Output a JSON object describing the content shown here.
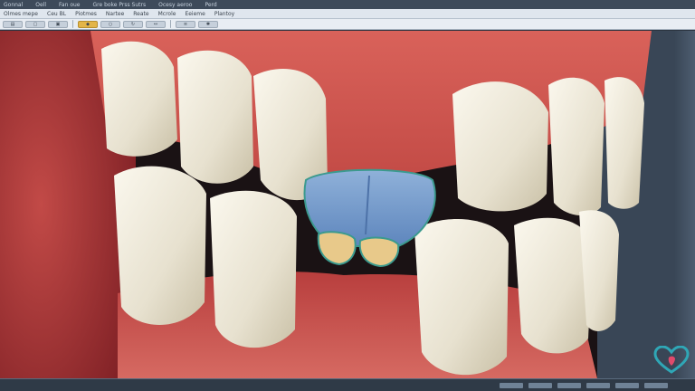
{
  "window": {
    "title_segments": [
      "Gonnal",
      "Oell",
      "Fan oue",
      "Gre boke Prss Sutrs",
      "Ocesy aeroo",
      "Perd"
    ]
  },
  "menubar": {
    "items": [
      "Olmes mepe",
      "Ceu BL",
      "Piotmes",
      "Nartee",
      "Reate",
      "Mcrole",
      "Eeieme",
      "Plantoy"
    ]
  },
  "toolbar": {
    "accent_color": "#e3b548",
    "tools": [
      "file-icon",
      "open-icon",
      "save-icon",
      "tooth-icon",
      "zoom-icon",
      "rotate-icon",
      "measure-icon",
      "layers-icon",
      "settings-icon"
    ]
  },
  "viewport": {
    "subject": "3D dental model — upper and lower teeth with highlighted blue gum/tooth region",
    "highlight_color": "#6f95c6",
    "highlight_edge_color": "#3b9a8e"
  },
  "logo": {
    "icon": "heart-tooth-logo-icon",
    "color": "#2fa7b6",
    "accent": "#e04a6b"
  }
}
